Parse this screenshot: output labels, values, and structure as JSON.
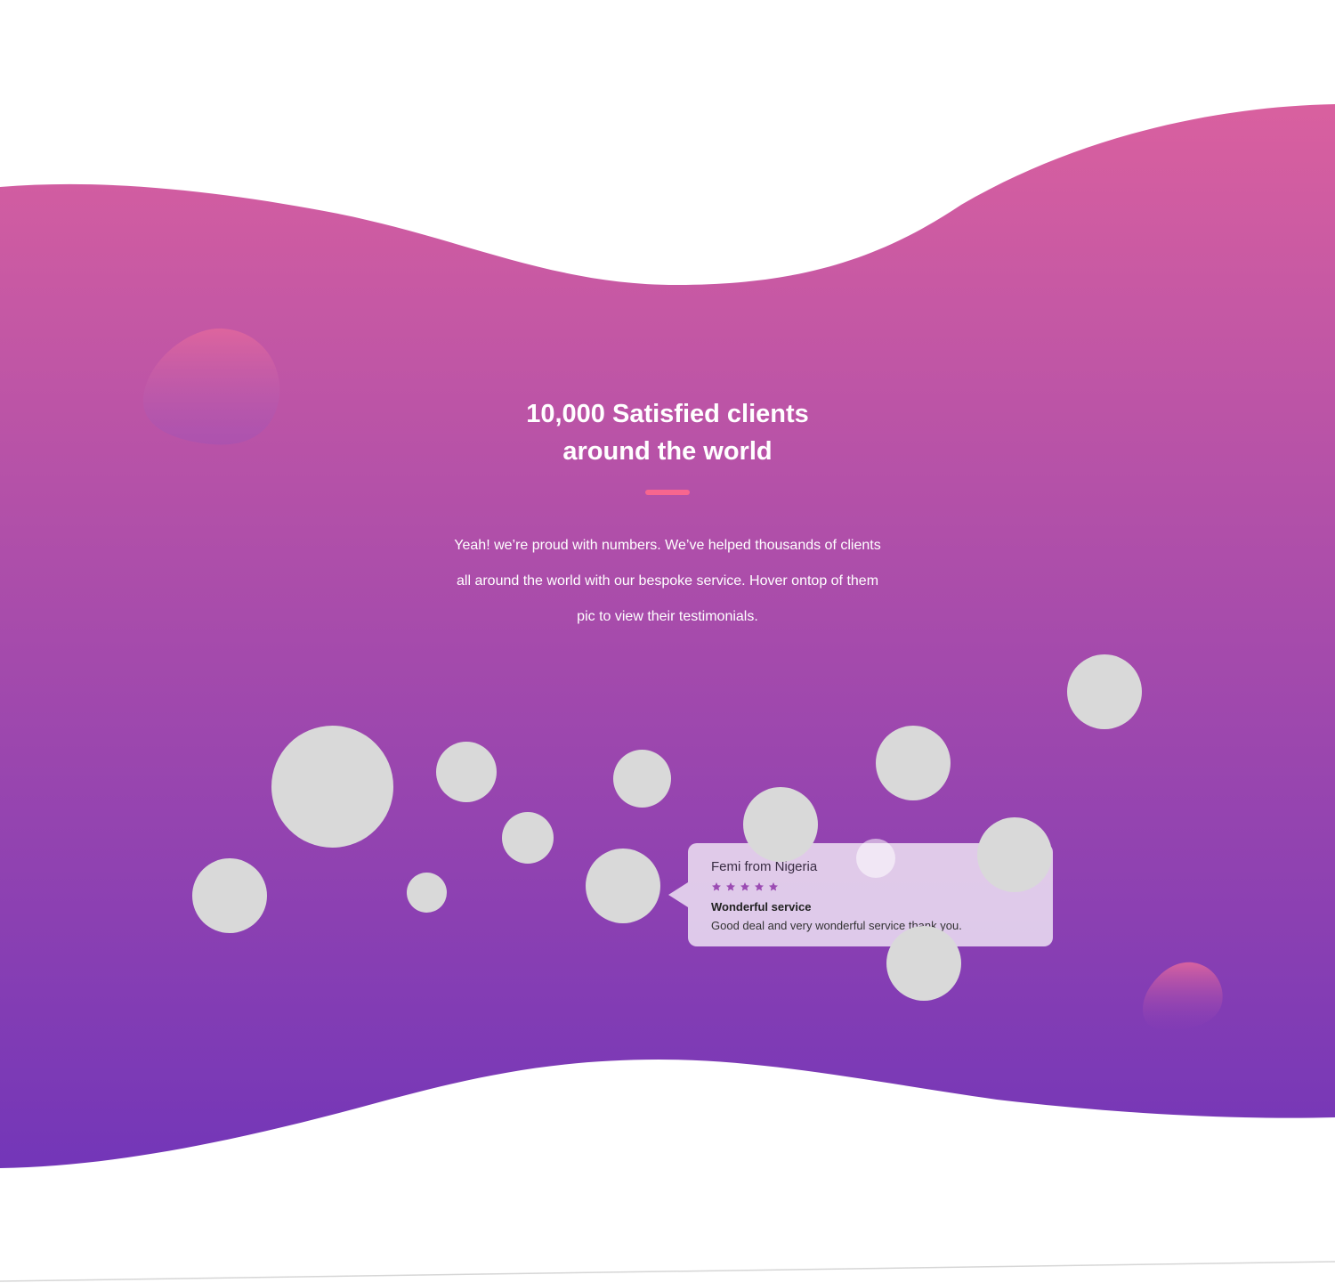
{
  "section": {
    "heading_line1": "10,000 Satisfied clients",
    "heading_line2": "around the world",
    "intro_line1": "Yeah! we’re proud with numbers. We’ve helped thousands of clients",
    "intro_line2": "all around the world with our bespoke service. Hover ontop of them",
    "intro_line3": "pic to view their testimonials."
  },
  "testimonial": {
    "name": "Femi from Nigeria",
    "rating": 5,
    "title": "Wonderful service",
    "text": "Good deal and very wonderful service thank you.",
    "icon": "bitcoin-icon",
    "icon_glyph": "₿"
  },
  "colors": {
    "gradient_top": "#d9609f",
    "gradient_bottom": "#7336b8",
    "divider": "#f7668f",
    "avatar_placeholder": "#d9d9d9",
    "star": "#9b4bb3"
  }
}
